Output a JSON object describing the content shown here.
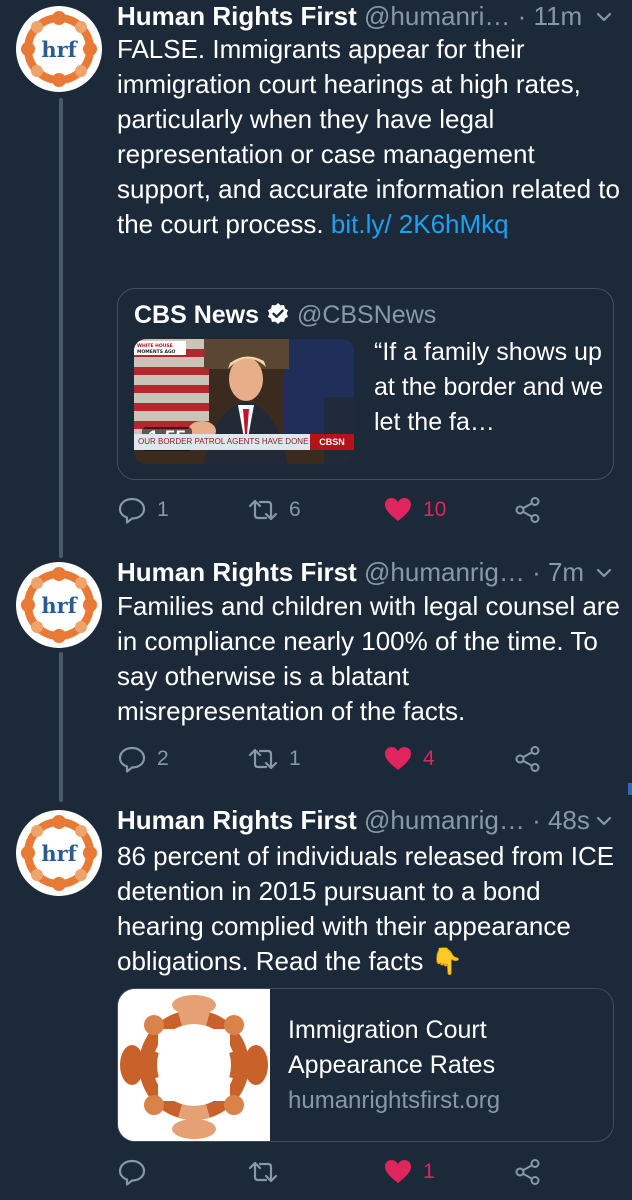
{
  "colors": {
    "background": "#1c2938",
    "text": "#ffffff",
    "secondary": "#8899a6",
    "link": "#1da1f2",
    "like": "#e0245e",
    "avatar_orange": "#e87a35"
  },
  "avatar_text": "hrf",
  "tweets": [
    {
      "name": "Human Rights First",
      "handle": "@humanri…",
      "time": "· 11m",
      "text": "FALSE. Immigrants appear for their immigration court hearings at high rates, particularly when they have legal representation or case management support, and accurate information related to the court process. ",
      "link": "bit.ly/ 2K6hMkq",
      "quote": {
        "name": "CBS News",
        "verified_icon": "verified-badge-icon",
        "handle": "@CBSNews",
        "text": "“If a family shows up at the border and we let the fa…",
        "video_duration": "1:55",
        "chyron": "OUR BORDER PATROL AGENTS HAVE DONE GREAT JOB",
        "chyron_brand": "CBSN",
        "badge": "WHITE HOUSE MOMENTS AGO"
      },
      "actions": {
        "replies": "1",
        "retweets": "6",
        "likes": "10"
      }
    },
    {
      "name": "Human Rights First",
      "handle": "@humanrig…",
      "time": "· 7m",
      "text": "Families and children with legal counsel are in compliance nearly 100% of the time. To say otherwise is a blatant misrepresentation of the facts.",
      "actions": {
        "replies": "2",
        "retweets": "1",
        "likes": "4"
      }
    },
    {
      "name": "Human Rights First",
      "handle": "@humanrig…",
      "time": "· 48s",
      "text": "86 percent of individuals released from ICE detention in 2015 pursuant to a bond hearing complied with their appearance obligations. Read the facts ",
      "emoji": "👇",
      "card": {
        "title": "Immigration Court Appearance Rates",
        "domain": "humanrightsfirst.org"
      },
      "actions": {
        "replies": "",
        "retweets": "",
        "likes": "1"
      }
    }
  ]
}
